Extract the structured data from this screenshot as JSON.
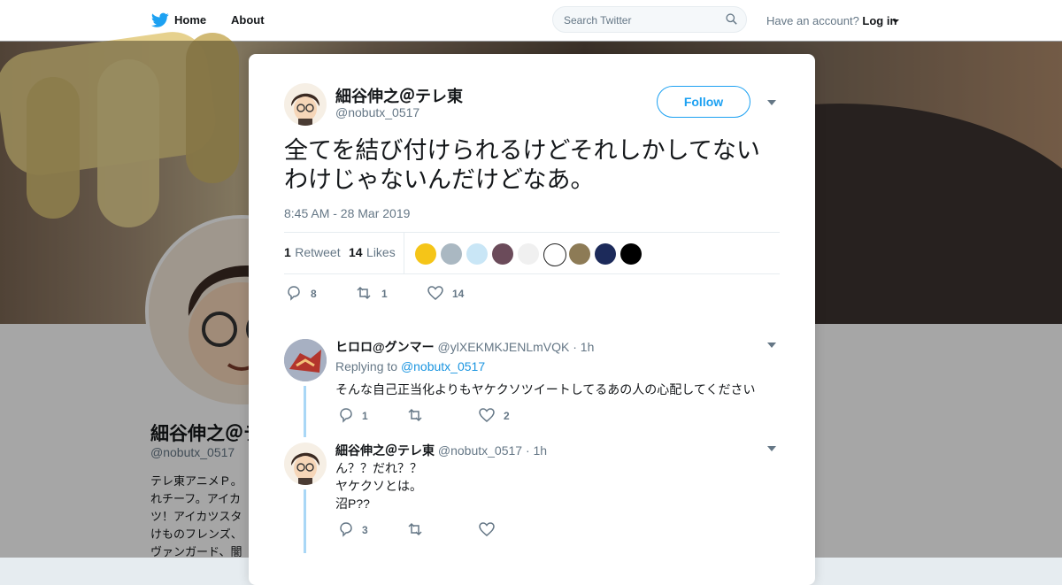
{
  "topnav": {
    "home": "Home",
    "about": "About",
    "search_placeholder": "Search Twitter",
    "have_account": "Have an account?",
    "login": "Log in"
  },
  "profile": {
    "name": "細谷伸之＠テ",
    "handle": "@nobutx_0517",
    "bio": "テレ東アニメＰ。れチーフ。アイカツ！アイカツスタけものフレンズ、ヴァンガード、闇"
  },
  "tweet": {
    "author_name": "細谷伸之＠テレ東",
    "author_handle": "@nobutx_0517",
    "follow_label": "Follow",
    "text": "全てを結び付けられるけどそれしかしてないわけじゃないんだけどなあ。",
    "timestamp": "8:45 AM - 28 Mar 2019",
    "retweets": "1",
    "retweets_label": "Retweet",
    "likes": "14",
    "likes_label": "Likes",
    "reply_count": "8",
    "retweet_count": "1",
    "like_count": "14"
  },
  "replies": [
    {
      "name": "ヒロロ@グンマー",
      "handle": "@ylXEKMKJENLmVQK",
      "time": "· 1h",
      "replying_to_label": "Replying to",
      "replying_to_handle": "@nobutx_0517",
      "text": "そんな自己正当化よりもヤケクソツイートしてるあの人の心配してください",
      "reply_count": "1",
      "like_count": "2"
    },
    {
      "name": "細谷伸之＠テレ東",
      "handle": "@nobutx_0517",
      "time": "· 1h",
      "text_lines": [
        "ん？？だれ？？",
        "ヤケクソとは。",
        "沼P??"
      ],
      "reply_count": "3"
    }
  ],
  "colors": {
    "accent": "#1da1f2",
    "text": "#14171a",
    "muted": "#657786"
  }
}
